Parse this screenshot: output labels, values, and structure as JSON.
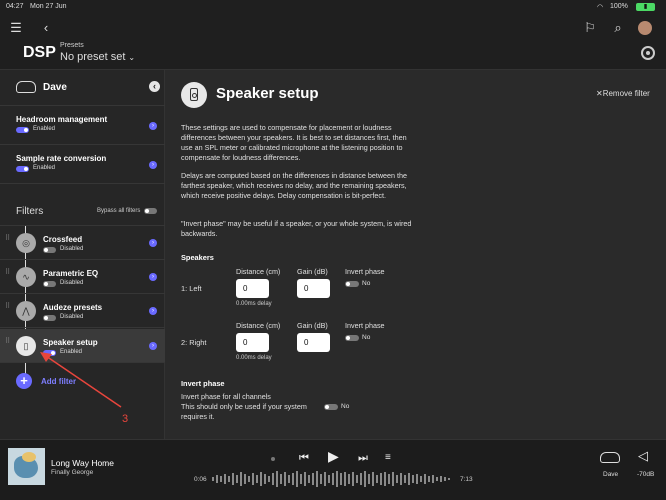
{
  "status": {
    "time": "04:27",
    "date": "Mon 27 Jun",
    "battery": "100%"
  },
  "header": {
    "app_title": "DSP",
    "presets_label": "Presets",
    "presets_value": "No preset set"
  },
  "sidebar": {
    "device_name": "Dave",
    "headroom": {
      "title": "Headroom management",
      "state": "Enabled"
    },
    "sample_rate": {
      "title": "Sample rate conversion",
      "state": "Enabled"
    },
    "filters_label": "Filters",
    "bypass_label": "Bypass all filters",
    "filters": [
      {
        "name": "Crossfeed",
        "state": "Disabled"
      },
      {
        "name": "Parametric EQ",
        "state": "Disabled"
      },
      {
        "name": "Audeze presets",
        "state": "Disabled"
      },
      {
        "name": "Speaker setup",
        "state": "Enabled"
      }
    ],
    "add_filter": "Add filter",
    "annotation": "3"
  },
  "main": {
    "title": "Speaker setup",
    "remove_filter": "Remove filter",
    "desc1": "These settings are used to compensate for placement or loudness differences between your speakers. It is best to set distances first, then use an SPL meter or calibrated microphone at the listening position to compensate for loudness differences.",
    "desc2": "Delays are computed based on the differences in distance between the farthest speaker, which receives no delay, and the remaining speakers, which receive positive delays. Delay compensation is bit-perfect.",
    "desc3": "\"Invert phase\" may be useful if a speaker, or your whole system, is wired backwards.",
    "speakers_label": "Speakers",
    "col_distance": "Distance (cm)",
    "col_gain": "Gain (dB)",
    "col_invert": "Invert phase",
    "channels": [
      {
        "label": "1: Left",
        "distance": "0",
        "gain": "0",
        "delay": "0.00ms delay",
        "invert": "No"
      },
      {
        "label": "2: Right",
        "distance": "0",
        "gain": "0",
        "delay": "0.00ms delay",
        "invert": "No"
      }
    ],
    "invert_section": "Invert phase",
    "invert_all_line1": "Invert phase for all channels",
    "invert_all_line2": "This should only be used if your system",
    "invert_all_line3": "requires it.",
    "invert_all_value": "No"
  },
  "player": {
    "song": "Long Way Home",
    "artist": "Finally George",
    "elapsed": "0:06",
    "total": "7:13",
    "output": "Dave",
    "volume": "-70dB"
  }
}
